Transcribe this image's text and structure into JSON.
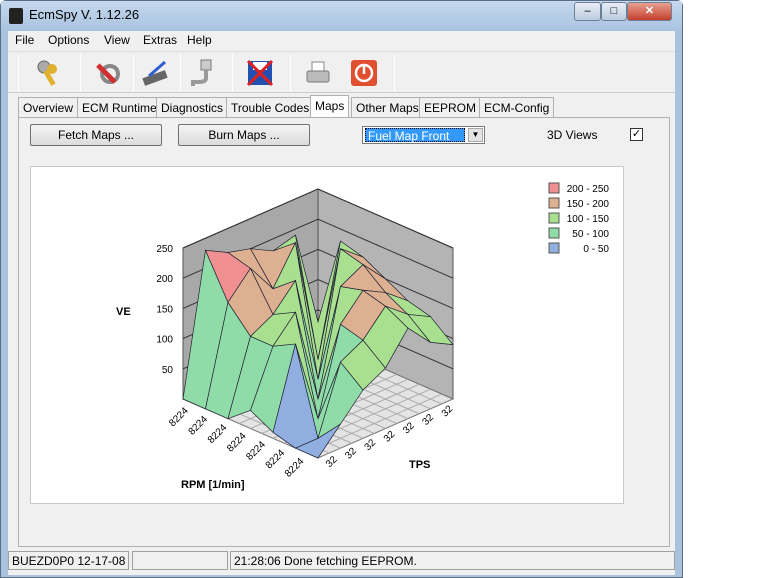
{
  "window": {
    "title": "EcmSpy V. 1.12.26",
    "min": "–",
    "max": "□",
    "close": "✕"
  },
  "menu": [
    "File",
    "Options",
    "View",
    "Extras",
    "Help"
  ],
  "toolbar": [
    "keys-icon",
    "settings-tools-icon",
    "chip-program-icon",
    "serial-cable-icon",
    "no-save-icon",
    "printer-icon",
    "power-icon"
  ],
  "tabs": [
    "Overview",
    "ECM Runtime",
    "Diagnostics",
    "Trouble Codes",
    "Maps",
    "Other Maps",
    "EEPROM",
    "ECM-Config"
  ],
  "active_tab": "Maps",
  "maps": {
    "fetch": "Fetch Maps ...",
    "burn": "Burn Maps ...",
    "map_select": "Fuel Map Front",
    "views_3d_label": "3D Views",
    "views_3d_checked": true,
    "check": "✓"
  },
  "chart_data": {
    "type": "surface3d",
    "ylabel": "VE",
    "xlabel": "RPM [1/min]",
    "zlabel": "TPS",
    "ylim": [
      0,
      250
    ],
    "yticks": [
      "50",
      "100",
      "150",
      "200",
      "250"
    ],
    "x_ticks": [
      "8224",
      "8224",
      "8224",
      "8224",
      "8224",
      "8224",
      "8224"
    ],
    "z_ticks": [
      "32",
      "32",
      "32",
      "32",
      "32",
      "32",
      "32"
    ],
    "legend": [
      {
        "label": "200 - 250",
        "color": "#f09090"
      },
      {
        "label": "150 - 200",
        "color": "#dcb090"
      },
      {
        "label": "100 - 150",
        "color": "#a8e090"
      },
      {
        "label": "50 - 100",
        "color": "#90dca8"
      },
      {
        "label": "0 - 50",
        "color": "#90aee0"
      }
    ],
    "values": [
      [
        30,
        190,
        180,
        200,
        210,
        230,
        0
      ],
      [
        180,
        0,
        210,
        150,
        200,
        160,
        0
      ],
      [
        170,
        200,
        0,
        180,
        140,
        120,
        0
      ],
      [
        150,
        190,
        170,
        0,
        160,
        120,
        30
      ],
      [
        130,
        160,
        180,
        140,
        0,
        140,
        10
      ],
      [
        120,
        140,
        170,
        130,
        110,
        0,
        0
      ],
      [
        90,
        110,
        150,
        100,
        80,
        40,
        0
      ]
    ]
  },
  "status": {
    "ecu": "BUEZD0P0 12-17-08",
    "middle": "",
    "message": "21:28:06 Done fetching EEPROM."
  }
}
